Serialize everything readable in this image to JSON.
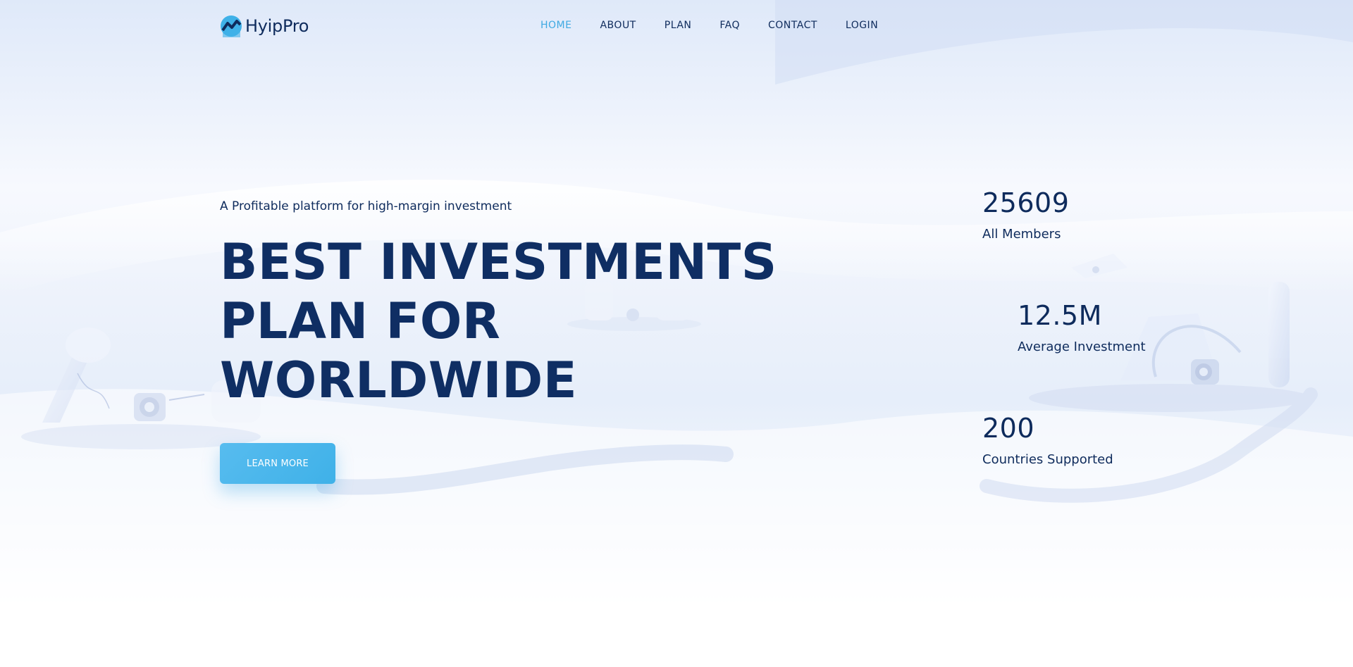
{
  "brand": {
    "name": "HyipPro"
  },
  "nav": {
    "items": [
      {
        "label": "HOME",
        "active": true
      },
      {
        "label": "ABOUT",
        "active": false
      },
      {
        "label": "PLAN",
        "active": false
      },
      {
        "label": "FAQ",
        "active": false
      },
      {
        "label": "CONTACT",
        "active": false
      },
      {
        "label": "LOGIN",
        "active": false
      }
    ]
  },
  "hero": {
    "kicker": "A Profitable platform for high-margin investment",
    "headline_lines": [
      "BEST INVESTMENTS",
      "PLAN FOR",
      "WORLDWIDE"
    ],
    "cta_label": "LEARN MORE"
  },
  "stats": [
    {
      "value": "25609",
      "label": "All Members"
    },
    {
      "value": "12.5M",
      "label": "Average Investment"
    },
    {
      "value": "200",
      "label": "Countries Supported"
    }
  ],
  "colors": {
    "primary_text": "#0e2b5c",
    "accent": "#3ea9e2",
    "button": "#4db8ec",
    "background": "#eef3fc"
  }
}
